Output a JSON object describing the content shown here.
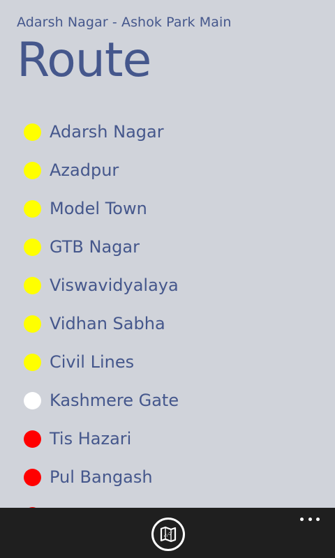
{
  "header": {
    "subtitle": "Adarsh Nagar - Ashok Park Main",
    "title": "Route"
  },
  "stations": [
    {
      "name": "Adarsh Nagar",
      "color": "#ffff00"
    },
    {
      "name": "Azadpur",
      "color": "#ffff00"
    },
    {
      "name": "Model Town",
      "color": "#ffff00"
    },
    {
      "name": "GTB Nagar",
      "color": "#ffff00"
    },
    {
      "name": "Viswavidyalaya",
      "color": "#ffff00"
    },
    {
      "name": "Vidhan Sabha",
      "color": "#ffff00"
    },
    {
      "name": "Civil Lines",
      "color": "#ffff00"
    },
    {
      "name": "Kashmere Gate",
      "color": "#ffffff"
    },
    {
      "name": "Tis Hazari",
      "color": "#ff0000"
    },
    {
      "name": "Pul Bangash",
      "color": "#ff0000"
    },
    {
      "name": "",
      "color": "#ff0000"
    }
  ],
  "appbar": {
    "map_icon": "map-icon",
    "more_icon": "more-icon"
  },
  "colors": {
    "background": "#d0d3da",
    "text": "#45578c",
    "appbar": "#1f1f1f"
  }
}
